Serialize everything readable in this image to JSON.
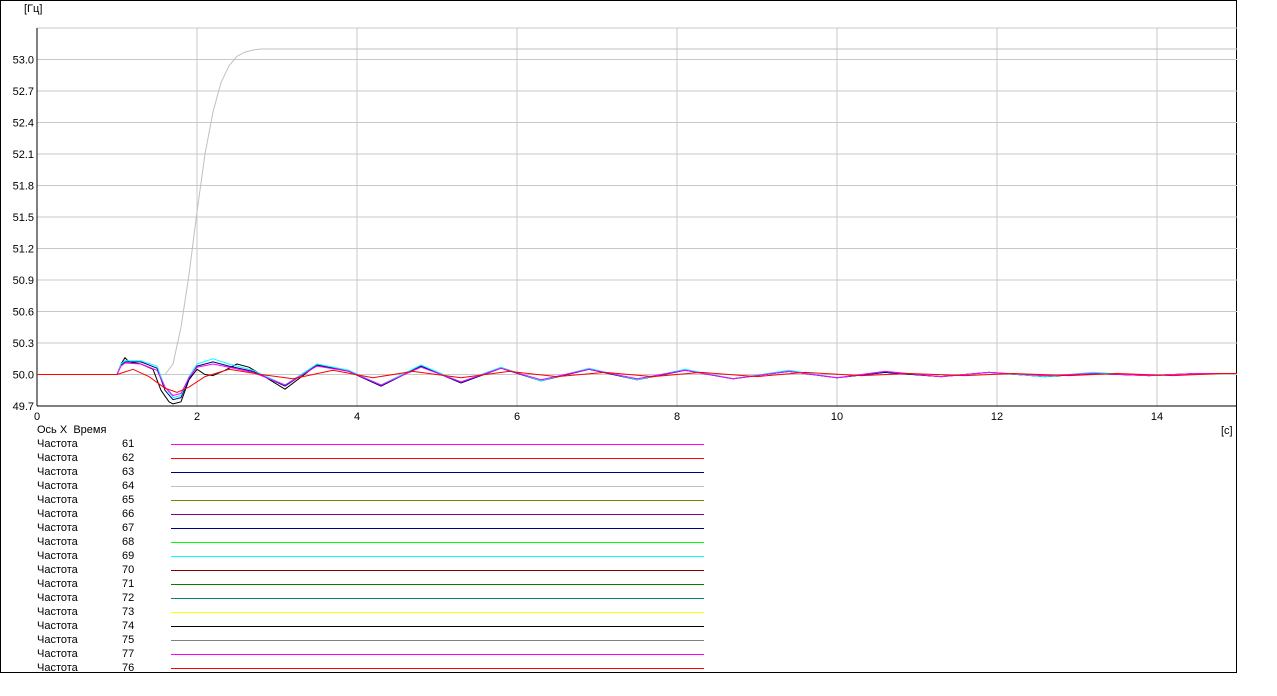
{
  "chart_data": {
    "type": "line",
    "ylabel": "[Гц]",
    "xlabel": "[с]",
    "xlim": [
      0,
      15
    ],
    "ylim": [
      49.7,
      53.3
    ],
    "xticks": [
      "0",
      "2",
      "4",
      "6",
      "8",
      "10",
      "12",
      "14"
    ],
    "yticks": [
      "49.7",
      "50.0",
      "50.3",
      "50.6",
      "50.9",
      "51.2",
      "51.5",
      "51.8",
      "52.1",
      "52.4",
      "52.7",
      "53.0"
    ],
    "grid": true,
    "legend_placement": "bottom-left",
    "legend_header": {
      "axis": "Ось X",
      "name": "Время"
    },
    "series": [
      {
        "label": "Частота",
        "id": "61",
        "color": "#ff00ff"
      },
      {
        "label": "Частота",
        "id": "62",
        "color": "#ff0000"
      },
      {
        "label": "Частота",
        "id": "63",
        "color": "#000080"
      },
      {
        "label": "Частота",
        "id": "64",
        "color": "#c0c0c0"
      },
      {
        "label": "Частота",
        "id": "65",
        "color": "#808000"
      },
      {
        "label": "Частота",
        "id": "66",
        "color": "#800080"
      },
      {
        "label": "Частота",
        "id": "67",
        "color": "#000080"
      },
      {
        "label": "Частота",
        "id": "68",
        "color": "#00ff00"
      },
      {
        "label": "Частота",
        "id": "69",
        "color": "#00ffff"
      },
      {
        "label": "Частота",
        "id": "70",
        "color": "#800000"
      },
      {
        "label": "Частота",
        "id": "71",
        "color": "#008000"
      },
      {
        "label": "Частота",
        "id": "72",
        "color": "#008080"
      },
      {
        "label": "Частота",
        "id": "73",
        "color": "#ffff00"
      },
      {
        "label": "Частота",
        "id": "74",
        "color": "#000000"
      },
      {
        "label": "Частота",
        "id": "75",
        "color": "#808080"
      },
      {
        "label": "Частота",
        "id": "77",
        "color": "#ff00ff"
      },
      {
        "label": "Частота",
        "id": "76",
        "color": "#ff0000"
      }
    ],
    "curves": [
      {
        "name": "64",
        "color": "#c0c0c0",
        "x": [
          0,
          1.0,
          1.6,
          1.7,
          1.8,
          1.9,
          2.0,
          2.1,
          2.2,
          2.3,
          2.4,
          2.5,
          2.6,
          2.7,
          2.8,
          3.0,
          15
        ],
        "y": [
          50.0,
          50.0,
          50.0,
          50.1,
          50.45,
          50.95,
          51.55,
          52.1,
          52.5,
          52.78,
          52.94,
          53.03,
          53.07,
          53.09,
          53.1,
          53.1,
          53.1
        ]
      },
      {
        "name": "74",
        "color": "#000000",
        "x": [
          0,
          1.0,
          1.05,
          1.1,
          1.15,
          1.3,
          1.45,
          1.55,
          1.65,
          1.7,
          1.8,
          1.9,
          2.0,
          2.1,
          2.2,
          2.35,
          2.5,
          2.65,
          2.8,
          3.1,
          3.5,
          3.9,
          4.3,
          4.8,
          5.3,
          5.8,
          6.3,
          6.9,
          7.5,
          8.1,
          8.7,
          9.4,
          10.0,
          10.6,
          11.3,
          11.9,
          12.6,
          13.2,
          13.9,
          14.5,
          15
        ],
        "y": [
          50.0,
          50.0,
          50.1,
          50.16,
          50.12,
          50.1,
          50.05,
          49.85,
          49.74,
          49.72,
          49.74,
          49.95,
          50.05,
          50.0,
          49.99,
          50.04,
          50.1,
          50.07,
          50.0,
          49.86,
          50.09,
          50.03,
          49.89,
          50.08,
          49.92,
          50.06,
          49.94,
          50.05,
          49.95,
          50.04,
          49.96,
          50.03,
          49.97,
          50.02,
          49.98,
          50.02,
          49.98,
          50.01,
          49.99,
          50.01,
          50.01
        ]
      },
      {
        "name": "63",
        "color": "#000080",
        "x": [
          0,
          1.0,
          1.05,
          1.1,
          1.3,
          1.5,
          1.6,
          1.7,
          1.8,
          1.9,
          2.0,
          2.2,
          2.4,
          2.7,
          3.1,
          3.5,
          3.9,
          4.3,
          4.8,
          5.3,
          5.8,
          6.3,
          6.9,
          7.5,
          8.1,
          8.7,
          9.4,
          10.0,
          10.6,
          11.3,
          11.9,
          12.6,
          13.2,
          13.9,
          14.5,
          15
        ],
        "y": [
          50.0,
          50.0,
          50.09,
          50.12,
          50.12,
          50.06,
          49.85,
          49.76,
          49.78,
          49.96,
          50.08,
          50.12,
          50.08,
          50.03,
          49.89,
          50.09,
          50.03,
          49.89,
          50.08,
          49.92,
          50.06,
          49.94,
          50.05,
          49.95,
          50.04,
          49.96,
          50.03,
          49.97,
          50.02,
          49.98,
          50.02,
          49.98,
          50.01,
          49.99,
          50.01,
          50.01
        ]
      },
      {
        "name": "69",
        "color": "#00ffff",
        "x": [
          0,
          1.0,
          1.05,
          1.1,
          1.3,
          1.5,
          1.6,
          1.7,
          1.8,
          1.9,
          2.0,
          2.2,
          2.4,
          2.7,
          3.1,
          3.5,
          3.9,
          4.3,
          4.8,
          5.3,
          5.8,
          6.3,
          6.9,
          7.5,
          8.1,
          8.7,
          9.4,
          10.0,
          10.6,
          11.3,
          11.9,
          12.6,
          13.2,
          13.9,
          14.5,
          15
        ],
        "y": [
          50.0,
          50.0,
          50.1,
          50.13,
          50.13,
          50.08,
          49.88,
          49.78,
          49.8,
          49.98,
          50.1,
          50.15,
          50.1,
          50.04,
          49.9,
          50.1,
          50.04,
          49.9,
          50.09,
          49.93,
          50.07,
          49.94,
          50.06,
          49.95,
          50.05,
          49.96,
          50.04,
          49.97,
          50.03,
          49.98,
          50.02,
          49.98,
          50.02,
          49.99,
          50.01,
          50.01
        ]
      },
      {
        "name": "77",
        "color": "#ff00ff",
        "x": [
          0,
          1.0,
          1.05,
          1.1,
          1.3,
          1.5,
          1.6,
          1.7,
          1.8,
          1.9,
          2.0,
          2.2,
          2.4,
          2.7,
          3.1,
          3.5,
          3.9,
          4.3,
          4.8,
          5.3,
          5.8,
          6.3,
          6.9,
          7.5,
          8.1,
          8.7,
          9.4,
          10.0,
          10.6,
          11.3,
          11.9,
          12.6,
          13.2,
          13.9,
          14.5,
          15
        ],
        "y": [
          50.0,
          50.0,
          50.08,
          50.11,
          50.1,
          50.04,
          49.88,
          49.8,
          49.82,
          49.97,
          50.07,
          50.1,
          50.07,
          50.02,
          49.9,
          50.08,
          50.03,
          49.9,
          50.07,
          49.93,
          50.06,
          49.95,
          50.05,
          49.96,
          50.04,
          49.96,
          50.03,
          49.97,
          50.03,
          49.98,
          50.02,
          49.99,
          50.01,
          49.99,
          50.01,
          50.01
        ]
      },
      {
        "name": "62",
        "color": "#ff0000",
        "x": [
          0,
          1.0,
          1.2,
          1.4,
          1.6,
          1.75,
          1.9,
          2.1,
          2.4,
          2.8,
          3.2,
          3.7,
          4.2,
          4.7,
          5.3,
          5.9,
          6.5,
          7.1,
          7.7,
          8.3,
          9.0,
          9.6,
          10.3,
          10.9,
          11.6,
          12.2,
          12.9,
          13.5,
          14.2,
          14.8,
          15
        ],
        "y": [
          50.0,
          50.0,
          50.05,
          49.98,
          49.87,
          49.83,
          49.88,
          49.98,
          50.05,
          50.0,
          49.96,
          50.04,
          49.97,
          50.03,
          49.97,
          50.03,
          49.98,
          50.02,
          49.98,
          50.02,
          49.98,
          50.02,
          49.99,
          50.01,
          49.99,
          50.01,
          49.99,
          50.01,
          49.99,
          50.01,
          50.01
        ]
      }
    ]
  }
}
